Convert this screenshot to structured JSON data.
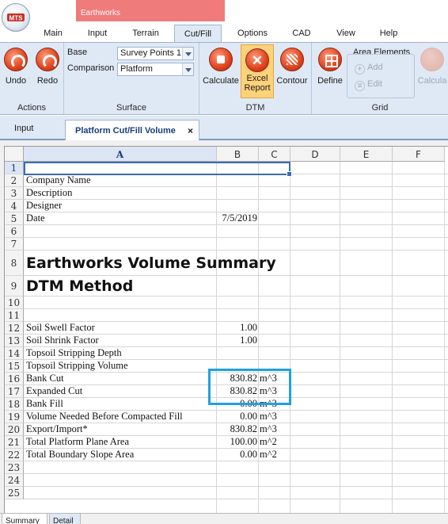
{
  "window": {
    "doc_tab_title": "Earthworks",
    "logo_text": "MTS"
  },
  "ribbon_tabs": [
    "Main",
    "Input",
    "Terrain",
    "Cut/Fill",
    "Options",
    "CAD",
    "View",
    "Help"
  ],
  "active_ribbon_tab": "Cut/Fill",
  "ribbon": {
    "actions": {
      "label": "Actions",
      "undo": "Undo",
      "redo": "Redo"
    },
    "surface": {
      "label": "Surface",
      "base_label": "Base",
      "base_value": "Survey Points 1",
      "comparison_label": "Comparison",
      "comparison_value": "Platform"
    },
    "dtm": {
      "label": "DTM",
      "calculate": "Calculate",
      "excel_report": "Excel\nReport",
      "excel_line1": "Excel",
      "excel_line2": "Report",
      "contour": "Contour"
    },
    "grid": {
      "label": "Grid",
      "define": "Define",
      "area_elements": "Area Elements",
      "add": "Add",
      "edit": "Edit",
      "calculate": "Calcula"
    }
  },
  "doc_tabs": {
    "input": "Input",
    "active": "Platform Cut/Fill Volume",
    "close": "×"
  },
  "sheet": {
    "columns": [
      "A",
      "B",
      "C",
      "D",
      "E",
      "F"
    ],
    "rows": [
      {
        "n": "1"
      },
      {
        "n": "2",
        "a": "Company Name"
      },
      {
        "n": "3",
        "a": "Description"
      },
      {
        "n": "4",
        "a": "Designer"
      },
      {
        "n": "5",
        "a": "Date",
        "b": "7/5/2019"
      },
      {
        "n": "6"
      },
      {
        "n": "7"
      },
      {
        "n": "8",
        "a": "Earthworks Volume Summary"
      },
      {
        "n": "9",
        "a": "DTM Method"
      },
      {
        "n": "10"
      },
      {
        "n": "11"
      },
      {
        "n": "12",
        "a": "Soil Swell Factor",
        "b": "1.00"
      },
      {
        "n": "13",
        "a": "Soil Shrink Factor",
        "b": "1.00"
      },
      {
        "n": "14",
        "a": "Topsoil Stripping Depth"
      },
      {
        "n": "15",
        "a": "Topsoil Stripping Volume"
      },
      {
        "n": "16",
        "a": "Bank Cut",
        "b": "830.82",
        "c": "m^3"
      },
      {
        "n": "17",
        "a": "Expanded Cut",
        "b": "830.82",
        "c": "m^3"
      },
      {
        "n": "18",
        "a": "Bank Fill",
        "b": "0.00",
        "c": "m^3"
      },
      {
        "n": "19",
        "a": "Volume Needed Before Compacted Fill",
        "b": "0.00",
        "c": "m^3"
      },
      {
        "n": "20",
        "a": "Export/Import*",
        "b": "830.82",
        "c": "m^3"
      },
      {
        "n": "21",
        "a": "Total Platform Plane Area",
        "b": "100.00",
        "c": "m^2"
      },
      {
        "n": "22",
        "a": "Total Boundary Slope Area",
        "b": "0.00",
        "c": "m^2"
      },
      {
        "n": "23"
      },
      {
        "n": "24"
      },
      {
        "n": "25"
      }
    ]
  },
  "sheet_tabs": [
    "Summary",
    "Detail"
  ],
  "colors": {
    "ribbon_bg": "#dfe9f5",
    "highlight_box": "#1ea2e0",
    "doc_tab_title_bg": "#f07b7b",
    "selection": "#3b6bb4"
  }
}
